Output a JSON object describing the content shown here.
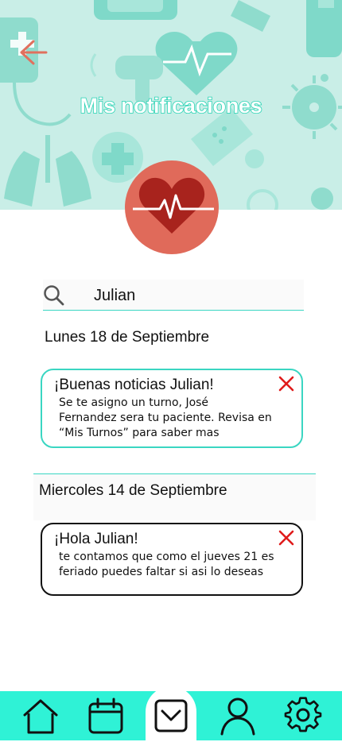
{
  "header": {
    "title": "Mis notificaciones"
  },
  "search": {
    "value": "Julian",
    "placeholder": ""
  },
  "groups": [
    {
      "date": "Lunes 18 de Septiembre",
      "notification": {
        "title": "¡Buenas noticias Julian!",
        "lines": [
          "Se  te asigno un turno, José",
          "Fernandez sera tu paciente. Revisa en",
          "“Mis Turnos” para saber mas"
        ]
      }
    },
    {
      "date": "Miercoles 14 de Septiembre",
      "notification": {
        "title": "¡Hola Julian!",
        "lines": [
          "te contamos que como el jueves 21 es",
          "feriado puedes faltar si asi lo deseas"
        ]
      }
    }
  ],
  "nav": {
    "items": [
      "home-icon",
      "calendar-icon",
      "inbox-icon",
      "user-icon",
      "gear-icon"
    ],
    "active": "inbox-icon"
  },
  "colors": {
    "accent": "#2ff2d6",
    "header_bg": "#c9eee7",
    "heart_circle": "#e06a5a",
    "close": "#e01b1b"
  }
}
